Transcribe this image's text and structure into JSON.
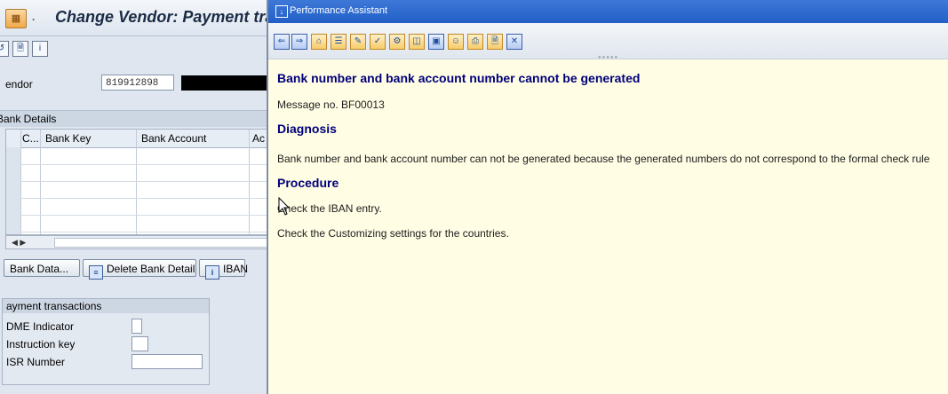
{
  "sap": {
    "title": "Change Vendor: Payment tra",
    "title_icon": "sap-transaction-icon",
    "toolbar": [
      "display-change-icon",
      "document-icon",
      "info-icon"
    ],
    "vendor_label": "endor",
    "vendor_value": "819912898",
    "bank_group_title": "Bank Details",
    "table_headers": [
      "C...",
      "Bank Key",
      "Bank Account",
      "Ac"
    ],
    "buttons": {
      "bank_data": "Bank Data...",
      "delete_bank_detail": "Delete Bank Detail",
      "iban": "IBAN"
    },
    "payment_group_title": "ayment transactions",
    "payment_fields": [
      {
        "label": "DME Indicator"
      },
      {
        "label": "Instruction key"
      },
      {
        "label": "ISR Number"
      }
    ]
  },
  "assistant": {
    "window_title": "Performance Assistant",
    "toolbar_icons": [
      "back-arrow-icon",
      "forward-arrow-icon",
      "home-icon",
      "tree-icon",
      "edit-icon",
      "highlight-icon",
      "technical-info-icon",
      "window-icon",
      "screen-icon",
      "help-icon",
      "print-icon",
      "document-icon",
      "close-icon"
    ],
    "heading": "Bank number and bank account number cannot be generated",
    "message_no": "Message no. BF00013",
    "diagnosis_title": "Diagnosis",
    "diagnosis_text": "Bank number and bank account number can not be generated because the generated numbers do not correspond to the formal check rule",
    "procedure_title": "Procedure",
    "procedure_line1": "Check the IBAN entry.",
    "procedure_line2": "Check the Customizing settings for the countries."
  },
  "colors": {
    "heading": "#00007a",
    "assistant_bg": "#fffde4",
    "titlebar": "#2a66cc"
  }
}
